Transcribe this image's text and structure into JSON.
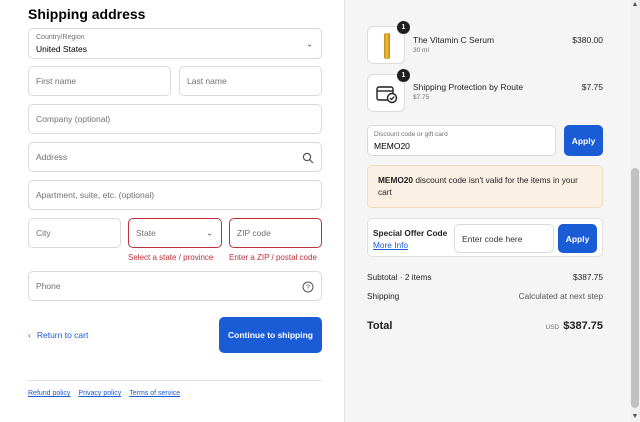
{
  "shipping": {
    "title": "Shipping address",
    "country_label": "Country/Region",
    "country_value": "United States",
    "first_name_placeholder": "First name",
    "last_name_placeholder": "Last name",
    "company_placeholder": "Company (optional)",
    "address_placeholder": "Address",
    "apartment_placeholder": "Apartment, suite, etc. (optional)",
    "city_placeholder": "City",
    "state_placeholder": "State",
    "zip_placeholder": "ZIP code",
    "state_error": "Select a state / province",
    "zip_error": "Enter a ZIP / postal code",
    "phone_placeholder": "Phone",
    "return_label": "Return to cart",
    "continue_label": "Continue to shipping"
  },
  "footer": {
    "links": [
      "Refund policy",
      "Privacy policy",
      "Terms of service"
    ]
  },
  "summary": {
    "items": [
      {
        "name": "The Vitamin C Serum",
        "sub": "30 ml",
        "price": "$380.00",
        "qty": "1",
        "icon": "serum-bottle-icon"
      },
      {
        "name": "Shipping Protection by Route",
        "sub": "$7.75",
        "price": "$7.75",
        "qty": "1",
        "icon": "route-package-icon"
      }
    ],
    "discount_label": "Discount code or gift card",
    "discount_value": "MEMO20",
    "apply_label": "Apply",
    "notice_code": "MEMO20",
    "notice_text": " discount code isn't valid for the items in your cart",
    "offer_title": "Special Offer Code",
    "offer_link": "More Info",
    "offer_placeholder": "Enter code here",
    "offer_apply": "Apply",
    "subtotal_label": "Subtotal · 2 items",
    "subtotal_value": "$387.75",
    "shipping_label": "Shipping",
    "shipping_value": "Calculated at next step",
    "total_label": "Total",
    "currency": "USD",
    "total_value": "$387.75"
  },
  "colors": {
    "accent": "#1a5bd6",
    "error": "#c0303a",
    "notice_bg": "#fbf0e4"
  }
}
